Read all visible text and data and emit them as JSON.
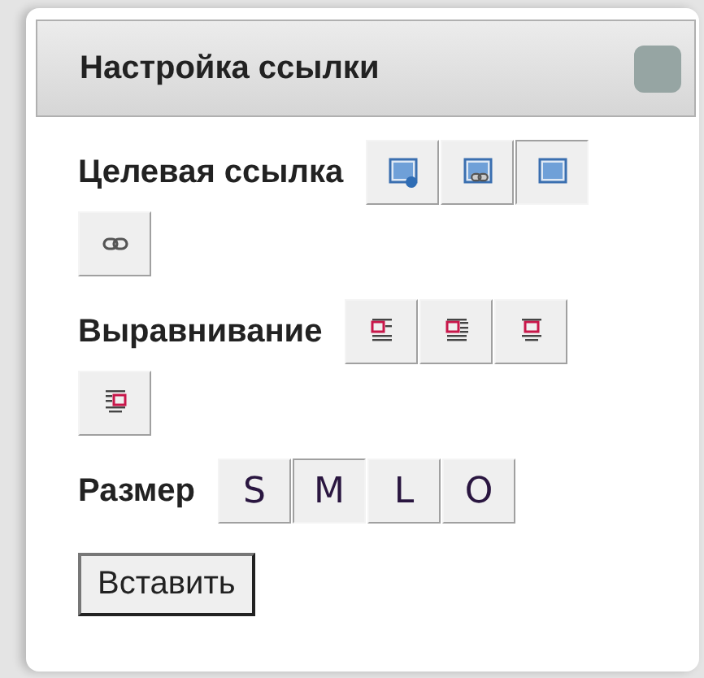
{
  "dialog": {
    "title": "Настройка ссылки"
  },
  "sections": [
    {
      "label": "Целевая ссылка",
      "kind": "icons",
      "buttons": [
        {
          "kind": "info",
          "selected": false
        },
        {
          "kind": "embed",
          "selected": false
        },
        {
          "kind": "image",
          "selected": true
        },
        {
          "kind": "link",
          "selected": false
        }
      ]
    },
    {
      "label": "Выравнивание",
      "kind": "icons",
      "buttons": [
        {
          "kind": "left",
          "selected": false
        },
        {
          "kind": "right",
          "selected": false
        },
        {
          "kind": "center",
          "selected": false
        },
        {
          "kind": "inline",
          "selected": false
        }
      ]
    },
    {
      "label": "Размер",
      "kind": "text",
      "buttons": [
        {
          "text": "S",
          "selected": false
        },
        {
          "text": "M",
          "selected": true
        },
        {
          "text": "L",
          "selected": false
        },
        {
          "text": "O",
          "selected": false
        }
      ]
    }
  ],
  "insert_button": "Вставить"
}
